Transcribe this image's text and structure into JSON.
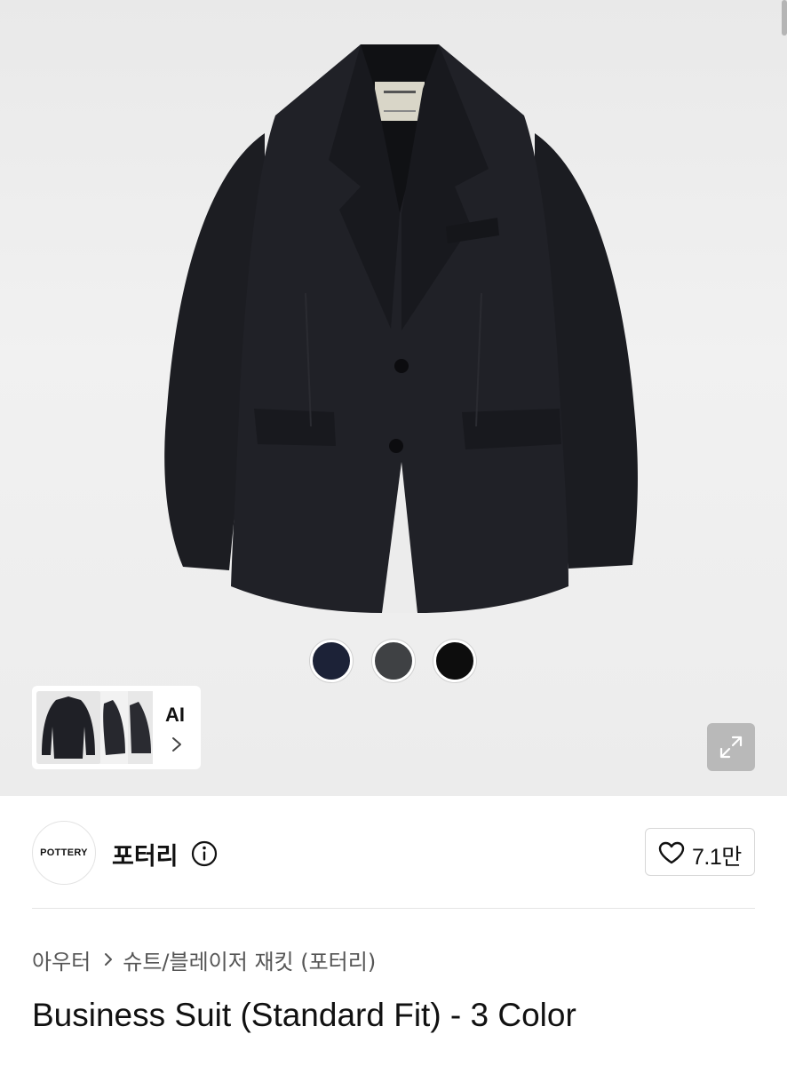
{
  "product_image": {
    "alt_icon": "jacket-image",
    "colors": [
      "#1c2237",
      "#3f4144",
      "#0d0d0d"
    ]
  },
  "thumbnails": {
    "ai_label": "AI"
  },
  "brand": {
    "logo_text": "POTTERY",
    "name": "포터리"
  },
  "like": {
    "count": "7.1만"
  },
  "breadcrumb": {
    "items": [
      "아우터",
      "슈트/블레이저 재킷 (포터리)"
    ]
  },
  "product": {
    "title": "Business Suit (Standard Fit) - 3 Color"
  }
}
